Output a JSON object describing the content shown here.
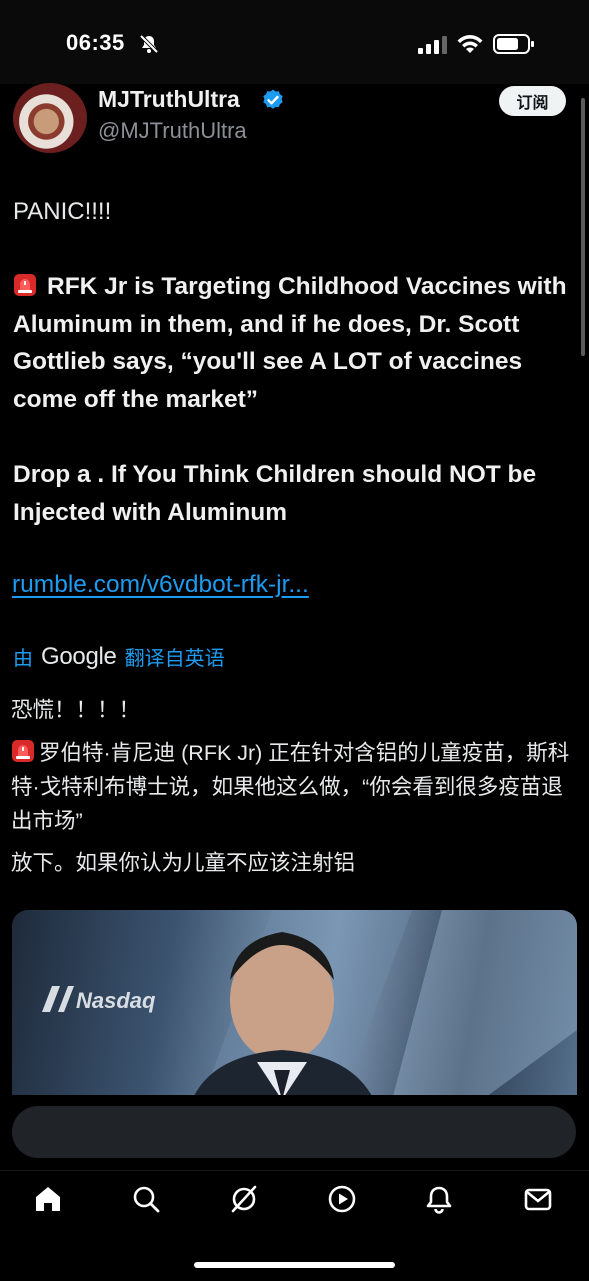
{
  "status_bar": {
    "time": "06:35"
  },
  "author": {
    "display_name": "MJTruthUltra",
    "handle": "@MJTruthUltra",
    "subscribe_label": "订阅"
  },
  "tweet": {
    "line_panic": "PANIC!!!!",
    "paragraph_1": "RFK Jr is Targeting Childhood Vaccines with Aluminum in them, and if he does, Dr. Scott Gottlieb says, “you'll see A LOT of vaccines come off the market”",
    "paragraph_2": "Drop a . If You Think Children should NOT be Injected with Aluminum",
    "link": "rumble.com/v6vdbot-rfk-jr..."
  },
  "translation": {
    "by_label": "由",
    "provider": "Google",
    "translated_label": "翻译自英语",
    "line_1": "恐慌！！！！",
    "line_2": "罗伯特·肯尼迪 (RFK Jr) 正在针对含铝的儿童疫苗，斯科特·戈特利布博士说，如果他这么做，“你会看到很多疫苗退出市场”",
    "line_3": "放下。如果你认为儿童不应该注射铝"
  },
  "media": {
    "watermark": "Nasdaq"
  },
  "reply": {
    "placeholder": ""
  },
  "nav": [
    "home-icon",
    "search-icon",
    "grok-icon",
    "video-icon",
    "notifications-icon",
    "messages-icon"
  ],
  "colors": {
    "accent": "#1d9bf0",
    "background": "#000000",
    "text": "#e7e9ea",
    "secondary": "#8b9096"
  }
}
